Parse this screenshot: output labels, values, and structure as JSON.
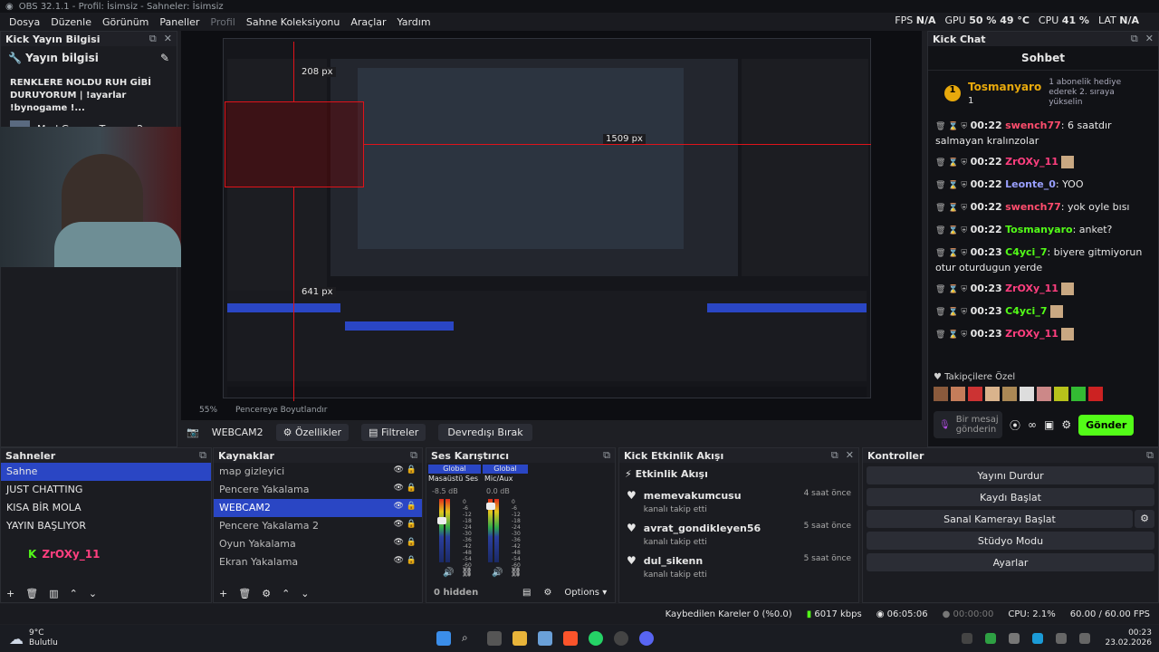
{
  "window": {
    "title": "OBS 32.1.1 - Profil: İsimsiz - Sahneler: İsimsiz"
  },
  "menu": [
    "Dosya",
    "Düzenle",
    "Görünüm",
    "Paneller",
    "Profil",
    "Sahne Koleksiyonu",
    "Araçlar",
    "Yardım"
  ],
  "stats": {
    "fps_label": "FPS",
    "fps_value": "N/A",
    "gpu_label": "GPU",
    "gpu_value": "50 % 49 °C",
    "cpu_label": "CPU",
    "cpu_value": "41 %",
    "lat_label": "LAT",
    "lat_value": "N/A"
  },
  "info_dock": {
    "title": "Kick Yayın Bilgisi",
    "heading": "Yayın bilgisi",
    "stream_title": "RENKLERE NOLDU RUH GİBİ DURUYORUM | !ayarlar !bynogame !...",
    "game": "Mad Games Tycoon 2"
  },
  "preview": {
    "px_208": "208 px",
    "px_1509": "1509 px",
    "px_641": "641 px",
    "zoom": "55%",
    "fit": "Pencereye Boyutlandır"
  },
  "source_toolbar": {
    "source": "WEBCAM2",
    "props": "Özellikler",
    "filters": "Filtreler",
    "deactivate": "Devredışı Bırak"
  },
  "scenes": {
    "title": "Sahneler",
    "items": [
      "Sahne",
      "JUST CHATTING",
      "KISA BİR MOLA",
      "YAYIN BAŞLIYOR"
    ],
    "selected": 0,
    "badge_user": "ZrOXy_11"
  },
  "sources": {
    "title": "Kaynaklar",
    "items": [
      "map gizleyici",
      "Pencere Yakalama",
      "WEBCAM2",
      "Pencere Yakalama 2",
      "Oyun Yakalama",
      "Ekran Yakalama"
    ],
    "selected": 2
  },
  "mixer": {
    "title": "Ses Karıştırıcı",
    "ch1": {
      "bus": "Global",
      "name": "Masaüstü Ses",
      "db": "-8.5 dB"
    },
    "ch2": {
      "bus": "Global",
      "name": "Mic/Aux",
      "db": "0.0 dB"
    },
    "scale": [
      "0",
      "-6",
      "-12",
      "-18",
      "-24",
      "-30",
      "-36",
      "-42",
      "-48",
      "-54",
      "-60"
    ],
    "hidden": "0 hidden",
    "options": "Options"
  },
  "activity": {
    "title": "Kick Etkinlik Akışı",
    "heading": "Etkinlik Akışı",
    "events": [
      {
        "user": "memevakumcusu",
        "sub": "kanalı takip etti",
        "time": "4 saat önce"
      },
      {
        "user": "avrat_gondikleyen56",
        "sub": "kanalı takip etti",
        "time": "5 saat önce"
      },
      {
        "user": "dul_sikenn",
        "sub": "kanalı takip etti",
        "time": "5 saat önce"
      }
    ]
  },
  "controls": {
    "title": "Kontroller",
    "stop_stream": "Yayını Durdur",
    "start_record": "Kaydı Başlat",
    "virtual_cam": "Sanal Kamerayı Başlat",
    "studio": "Stüdyo Modu",
    "settings": "Ayarlar"
  },
  "chat": {
    "title": "Kick Chat",
    "header": "Sohbet",
    "pinned_user": "Tosmanyaro",
    "pinned_count": "1",
    "pinned_msg": "1 abonelik hediye ederek 2. sıraya yükselin",
    "messages": [
      {
        "time": "00:22",
        "user": "swench77",
        "text": "6 saatdır salmayan kralınzolar",
        "color": "#ff4d6d"
      },
      {
        "time": "00:22",
        "user": "ZrOXy_11",
        "text": "",
        "color": "#ff3f7f"
      },
      {
        "time": "00:22",
        "user": "Leonte_0",
        "text": "YOO",
        "color": "#9aa0ff"
      },
      {
        "time": "00:22",
        "user": "swench77",
        "text": "yok oyle bısı",
        "color": "#ff4d6d"
      },
      {
        "time": "00:22",
        "user": "Tosmanyaro",
        "text": "anket?",
        "color": "#53fc18"
      },
      {
        "time": "00:23",
        "user": "C4yci_7",
        "text": "biyere gitmiyorun otur oturdugun yerde",
        "color": "#53fc18"
      },
      {
        "time": "00:23",
        "user": "ZrOXy_11",
        "text": "",
        "color": "#ff3f7f"
      },
      {
        "time": "00:23",
        "user": "C4yci_7",
        "text": "",
        "color": "#53fc18"
      },
      {
        "time": "00:23",
        "user": "ZrOXy_11",
        "text": "",
        "color": "#ff3f7f"
      }
    ],
    "followers_label": "Takipçilere Özel",
    "input_placeholder": "Bir mesaj gönderin",
    "send": "Gönder"
  },
  "statusbar": {
    "dropped": "Kaybedilen Kareler 0 (%0.0)",
    "kbps": "6017 kbps",
    "stream_time": "06:05:06",
    "rec_time": "00:00:00",
    "cpu": "CPU: 2.1%",
    "fps": "60.00 / 60.00 FPS"
  },
  "taskbar": {
    "temp": "9°C",
    "weather": "Bulutlu",
    "clock": "00:23",
    "date": "23.02.2026"
  },
  "colors": {
    "accent": "#2a46c4",
    "kick_green": "#53fc18",
    "red": "#e0131a"
  }
}
